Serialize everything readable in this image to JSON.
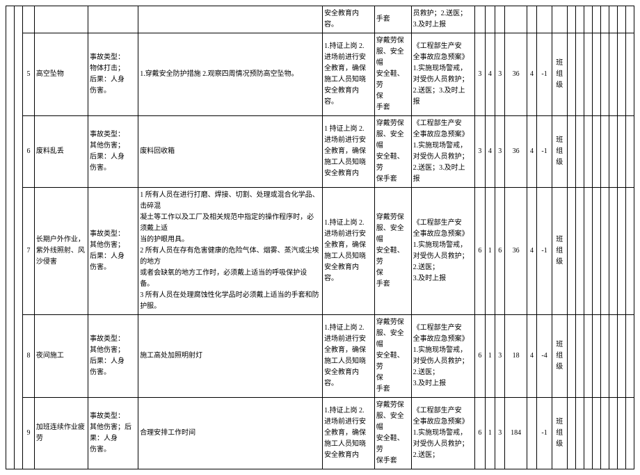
{
  "rows": [
    {
      "idx": "",
      "name": "",
      "type": "",
      "measure": "",
      "train": "安全教育内容。",
      "ppe": "手套",
      "plan": "员救护；2.送医；\n3.及时上报",
      "s1": "",
      "s2": "",
      "s3": "",
      "s4": "",
      "s5": "",
      "s6": "",
      "lvl": ""
    },
    {
      "idx": "5",
      "name": "高空坠物",
      "type": "事故类型：\n物体打击；\n后果：人身\n伤害。",
      "measure": "1.穿戴安全防护措施 2.观察四周情况预防高空坠物。",
      "train": "1.持证上岗 2.\n进场前进行安\n全教育，确保\n施工人员知晓\n安全教育内\n容。",
      "ppe": "穿戴劳保\n服、安全帽\n安全鞋、劳\n保\n手套",
      "plan": "《工程部生产安\n全事故应急预案》\n1.实施现场警戒，\n对受伤人员救护；\n2.送医；3.及时上\n报",
      "s1": "3",
      "s2": "4",
      "s3": "3",
      "s4": "36",
      "s5": "4",
      "s6": "-1",
      "lvl": "班\n组\n级"
    },
    {
      "idx": "6",
      "name": "废料乱丢",
      "type": "事故类型：\n其他伤害；\n后果：人身\n伤害。",
      "measure": "废料回收箱",
      "train": "1 持证上岗 2.\n进场前进行安\n全教育，确保\n施工人员知晓\n安全教育内",
      "ppe": "穿戴劳保\n服、安全帽\n安全鞋、劳\n保手套",
      "plan": "《工程部生产安\n全事故应急预案》\n1.实施现场警戒，\n对受伤人员救护；\n2.送医；3.及时上\n报",
      "s1": "3",
      "s2": "4",
      "s3": "3",
      "s4": "36",
      "s5": "4",
      "s6": "-1",
      "lvl": "班\n组\n级"
    },
    {
      "idx": "7",
      "name": "长期户外作业，\n紫外线照射、风\n沙侵害",
      "type": "事故类型：\n其他伤害；\n后果：人身\n伤害。",
      "measure": "1 所有人员在进行打磨、焊接、切割、处理或混合化学品、击碎混\n凝土等工作以及工厂及相关规范中指定的操作程序时，必须戴上适\n当的护眼用具。\n2 所有人员在存有危害健康的危险气体、烟雾、蒸汽或尘埃的地方\n或者会缺氧的地方工作时，必须戴上适当的呼吸保护设备。\n3 所有人员在处理腐蚀性化学品时必须戴上适当的手套和防护服。",
      "train": "1.持证上岗 2.\n进场前进行安\n全教育，确保\n施工人员知晓\n安全教育内\n容。",
      "ppe": "穿戴劳保\n服、安全帽\n安全鞋、劳\n保\n手套",
      "plan": "《工程部生产安\n全事故应急预案》\n1.实施现场警戒，\n对受伤人员救护；\n2.送医；\n3.及时上报",
      "s1": "6",
      "s2": "1",
      "s3": "6",
      "s4": "36",
      "s5": "4",
      "s6": "-1",
      "lvl": "班\n组\n级"
    },
    {
      "idx": "8",
      "name": "夜间施工",
      "type": "事故类型：\n其他伤害；\n后果：人身\n伤害。",
      "measure": "施工高处加照明射灯",
      "train": "1.持证上岗 2.\n进场前进行安\n全教育，确保\n施工人员知晓\n安全教育内\n容。",
      "ppe": "穿戴劳保\n服、安全帽\n安全鞋、劳\n保\n手套",
      "plan": "《工程部生产安\n全事故应急预案》\n1.实施现场警戒，\n对受伤人员救护；\n2.送医；\n3.及时上报",
      "s1": "6",
      "s2": "1",
      "s3": "3",
      "s4": "18",
      "s5": "4",
      "s6": "-4",
      "lvl": "班\n组\n级"
    },
    {
      "idx": "9",
      "name": "加班连续作业疲\n劳",
      "type": "事故类型：\n其他伤害；后\n果：人身\n伤害。",
      "measure": "合理安排工作时间",
      "train": "1.持证上岗 2.\n进场前进行安\n全教育，确保\n施工人员知晓\n安全教育内",
      "ppe": "穿戴劳保\n服、安全帽\n安全鞋、劳\n保手套",
      "plan": "《工程部生产安\n全事故应急预案》\n1.实施现场警戒，\n对受伤人员救护；\n2.送医；",
      "s1": "6",
      "s2": "1",
      "s3": "3",
      "s4": "184",
      "s5": "",
      "s6": "-1",
      "lvl": "班\n组\n级"
    }
  ]
}
